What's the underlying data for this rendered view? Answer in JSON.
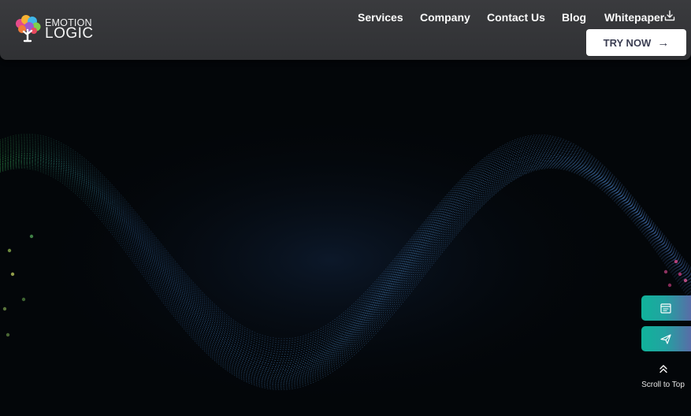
{
  "brand": {
    "line1": "EMOTION",
    "line2": "LOGIC"
  },
  "nav": {
    "items": [
      "Services",
      "Company",
      "Contact Us",
      "Blog",
      "Whitepaper"
    ],
    "cta_label": "TRY NOW",
    "cta_arrow": "→"
  },
  "side_actions": [
    {
      "icon": "browser-window-icon"
    },
    {
      "icon": "paper-plane-icon"
    }
  ],
  "scroll_top": {
    "label": "Scroll to Top",
    "icon": "double-chevron-up-icon"
  },
  "colors": {
    "navbar": "#343538",
    "background": "#030609",
    "wave_blue": "#4d9fe8",
    "wave_green": "#3fcf5a",
    "accent_teal": "#10b39a",
    "accent_purple": "#5d68a8",
    "button_text": "#3b3e52"
  }
}
